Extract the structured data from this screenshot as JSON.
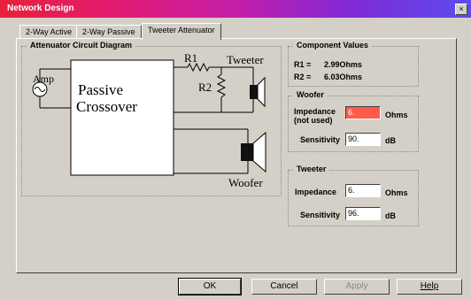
{
  "window": {
    "title": "Network Design",
    "close_glyph": "×"
  },
  "tabs": [
    "2-Way Active",
    "2-Way Passive",
    "Tweeter Attenuator"
  ],
  "diagram": {
    "group_title": "Attenuator Circuit Diagram",
    "amp": "Amp",
    "crossover_line1": "Passive",
    "crossover_line2": "Crossover",
    "r1": "R1",
    "r2": "R2",
    "tweeter": "Tweeter",
    "woofer": "Woofer"
  },
  "components": {
    "group_title": "Component Values",
    "r1_label": "R1 =",
    "r1_value": "2.99Ohms",
    "r2_label": "R2 =",
    "r2_value": "6.03Ohms"
  },
  "woofer": {
    "group_title": "Woofer",
    "impedance_label_1": "Impedance",
    "impedance_label_2": "(not used)",
    "impedance_value": "6.",
    "impedance_unit": "Ohms",
    "sensitivity_label": "Sensitivity",
    "sensitivity_value": "90.",
    "sensitivity_unit": "dB"
  },
  "tweeter": {
    "group_title": "Tweeter",
    "impedance_label": "Impedance",
    "impedance_value": "6.",
    "impedance_unit": "Ohms",
    "sensitivity_label": "Sensitivity",
    "sensitivity_value": "96.",
    "sensitivity_unit": "dB"
  },
  "buttons": {
    "ok": "OK",
    "cancel": "Cancel",
    "apply": "Apply",
    "help": "Help"
  },
  "colors": {
    "title_start": "#e8203a",
    "title_end": "#5b4dee",
    "highlight": "#ff5a4a"
  }
}
